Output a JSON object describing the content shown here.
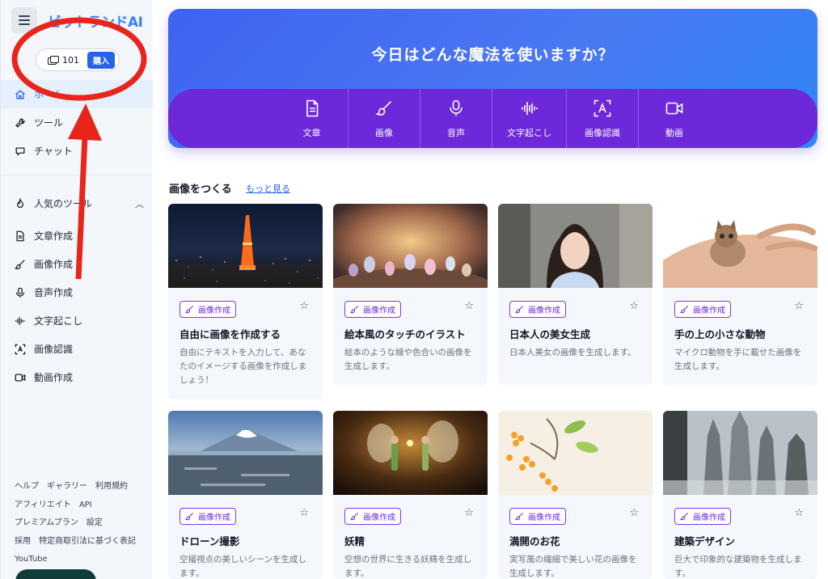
{
  "sidebar": {
    "brand": "ビットランドAI",
    "credits": {
      "count": "101",
      "buy_label": "購入"
    },
    "nav": [
      {
        "label": "ホーム",
        "icon": "home-icon"
      },
      {
        "label": "ツール",
        "icon": "wrench-icon"
      },
      {
        "label": "チャット",
        "icon": "chat-icon"
      }
    ],
    "popular": {
      "heading": "人気のツール",
      "items": [
        {
          "label": "文章作成",
          "icon": "document-icon"
        },
        {
          "label": "画像作成",
          "icon": "brush-icon"
        },
        {
          "label": "音声作成",
          "icon": "microphone-icon"
        },
        {
          "label": "文字起こし",
          "icon": "waveform-icon"
        },
        {
          "label": "画像認識",
          "icon": "scan-text-icon"
        },
        {
          "label": "動画作成",
          "icon": "video-icon"
        }
      ]
    },
    "footer": {
      "row1": [
        "ヘルプ",
        "ギャラリー",
        "利用規約"
      ],
      "row2": [
        "アフィリエイト",
        "API"
      ],
      "row3": [
        "プレミアムプラン",
        "設定"
      ],
      "row4": [
        "採用",
        "特定商取引法に基づく表記"
      ],
      "row5": [
        "YouTube"
      ]
    }
  },
  "hero": {
    "title": "今日はどんな魔法を使いますか？",
    "tools": [
      {
        "label": "文章",
        "icon": "document-icon"
      },
      {
        "label": "画像",
        "icon": "brush-icon"
      },
      {
        "label": "音声",
        "icon": "microphone-icon"
      },
      {
        "label": "文字起こし",
        "icon": "waveform-icon"
      },
      {
        "label": "画像認識",
        "icon": "scan-text-icon"
      },
      {
        "label": "動画",
        "icon": "video-icon"
      }
    ]
  },
  "section": {
    "title": "画像をつくる",
    "more_label": "もっと見る"
  },
  "cards": [
    {
      "tag": "画像作成",
      "title": "自由に画像を作成する",
      "desc": "自由にテキストを入力して、あなたのイメージする画像を作成しましょう！"
    },
    {
      "tag": "画像作成",
      "title": "絵本風のタッチのイラスト",
      "desc": "絵本のような線や色合いの画像を生成します。"
    },
    {
      "tag": "画像作成",
      "title": "日本人の美女生成",
      "desc": "日本人美女の画像を生成します。"
    },
    {
      "tag": "画像作成",
      "title": "手の上の小さな動物",
      "desc": "マイクロ動物を手に載せた画像を生成します。"
    },
    {
      "tag": "画像作成",
      "title": "ドローン撮影",
      "desc": "空撮視点の美しいシーンを生成します。"
    },
    {
      "tag": "画像作成",
      "title": "妖精",
      "desc": "空想の世界に生きる妖精を生成します。"
    },
    {
      "tag": "画像作成",
      "title": "満開のお花",
      "desc": "実写風の繊細で美しい花の画像を生成します。"
    },
    {
      "tag": "画像作成",
      "title": "建築デザイン",
      "desc": "巨大で印象的な建築物を生成します。"
    }
  ],
  "colors": {
    "accent": "#2563eb",
    "hero_bar": "#6d28d9",
    "tag": "#7c3aed",
    "annotation": "#e8251b"
  }
}
